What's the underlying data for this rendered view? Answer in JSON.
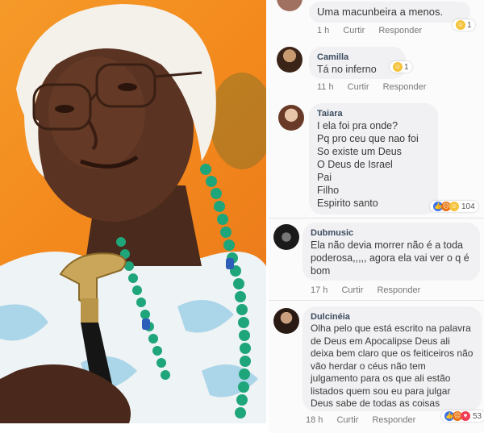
{
  "comments": [
    {
      "text": "Uma  macunbeira  a menos.",
      "time": "1 h",
      "like_label": "Curtir",
      "reply_label": "Responder",
      "reaction_count": "1",
      "reactions": [
        "haha-icon"
      ]
    },
    {
      "author": "Camilla",
      "text": "Tá no inferno",
      "time": "11 h",
      "like_label": "Curtir",
      "reply_label": "Responder",
      "reaction_count": "1",
      "reactions": [
        "haha-icon"
      ]
    },
    {
      "author": "Taiara",
      "text": "I ela foi pra onde?\nPq pro ceu que nao foi\nSo existe um Deus\nO Deus de Israel\nPai\nFilho\nEspirito santo",
      "reaction_count": "104",
      "reactions": [
        "like-icon",
        "angry-icon",
        "haha-icon"
      ]
    },
    {
      "author": "Dubmusic",
      "text": "Ela não devia morrer não é a toda poderosa,,,,, agora ela vai ver o q é bom",
      "time": "17 h",
      "like_label": "Curtir",
      "reply_label": "Responder"
    },
    {
      "author": "Dulcinéia",
      "text": "Olha pelo que está escrito na palavra de Deus em Apocalipse Deus ali deixa bem claro que os feiticeiros não vão herdar o céus não tem julgamento para os que ali estão listados quem sou eu para julgar Deus sabe de todas as coisas",
      "time": "18 h",
      "like_label": "Curtir",
      "reply_label": "Responder",
      "reaction_count": "53",
      "reactions": [
        "like-icon",
        "angry-icon",
        "love-icon"
      ]
    }
  ],
  "colors": {
    "bubble": "#f1f1f3",
    "author": "#3c4c60",
    "like": "#3b73e8",
    "haha": "#f5c33b",
    "angry": "#e9710f",
    "love": "#ef3e55",
    "photo_background": "#f3881c",
    "bead": "#1fa57a"
  }
}
